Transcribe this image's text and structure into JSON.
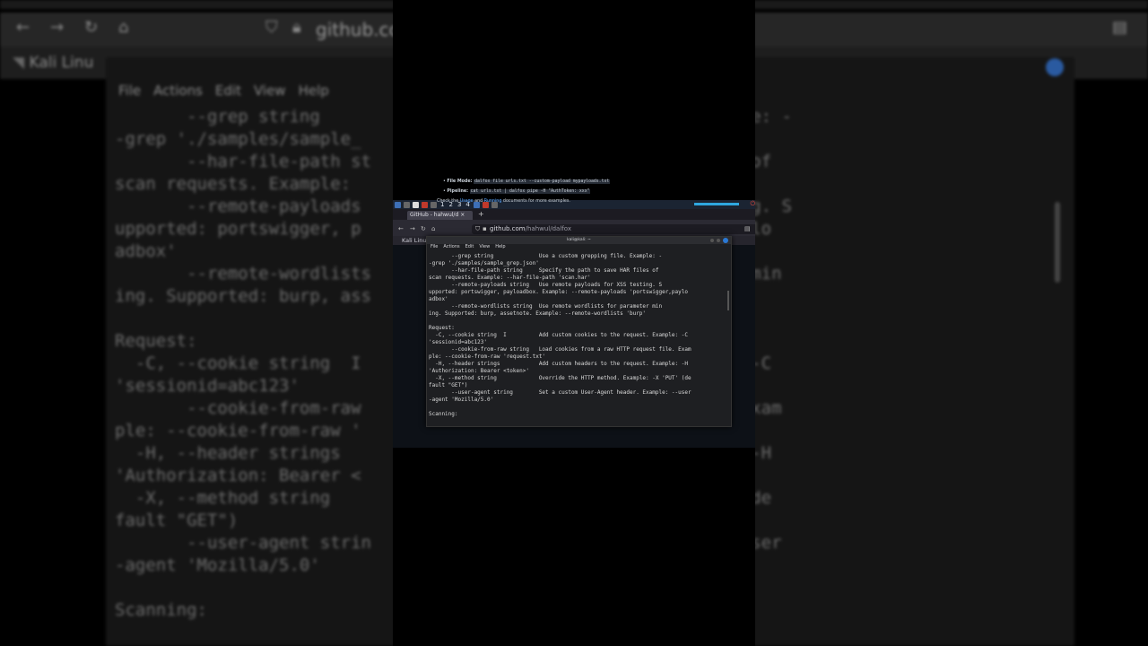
{
  "background": {
    "url_text": "github.co",
    "bookmark_label": "Kali Linu",
    "menu": [
      "File",
      "Actions",
      "Edit",
      "View",
      "Help"
    ],
    "lines": [
      "       --grep string                     grepping file. Example: -",
      "-grep './samples/sample_",
      "       --har-file-path st               ath to save HAR files of",
      "scan requests. Example:",
      "       --remote-payloads                ayloads for XSS testing. S",
      "upported: portswigger, p                loads 'portswigger,paylo",
      "adbox'",
      "       --remote-wordlists               rdlists for parameter min",
      "ing. Supported: burp, ass               lists 'burp'",
      "",
      "Request:",
      "  -C, --cookie string  I                the request. Example: -C",
      "'sessionid=abc123'",
      "       --cookie-from-raw                w HTTP request file. Exam",
      "ple: --cookie-from-raw '",
      "  -H, --header strings                  the request. Example: -H",
      "'Authorization: Bearer <",
      "  -X, --method string                  od. Example: -X 'PUT' (de",
      "fault \"GET\")",
      "       --user-agent strin               t header. Example: --user",
      "-agent 'Mozilla/5.0'",
      "",
      "Scanning:"
    ]
  },
  "taskbar": {
    "workspaces": [
      "1",
      "2",
      "3",
      "4"
    ]
  },
  "browser": {
    "tab_title": "GitHub - hahwul/d",
    "tab_plus": "+",
    "url_domain": "github.com",
    "url_path": "/hahwul/dalfox",
    "bookmark": "Kali Linux"
  },
  "github": {
    "item1_label": "File Mode:",
    "item1_code": "dalfox file urls.txt --custom-payload mypayloads.txt",
    "item2_label": "Pipeline:",
    "item2_code": "cat urls.txt | dalfox pipe -H \"AuthToken: xxx\"",
    "check_text_1": "Check the",
    "check_link_1": "Usage",
    "check_text_2": "and",
    "check_link_2": "Running",
    "check_text_3": "documents for more examples."
  },
  "terminal": {
    "title": "kali@kali: ~",
    "menu": [
      "File",
      "Actions",
      "Edit",
      "View",
      "Help"
    ],
    "lines": [
      "       --grep string              Use a custom grepping file. Example: -",
      "-grep './samples/sample_grep.json'",
      "       --har-file-path string     Specify the path to save HAR files of",
      "scan requests. Example: --har-file-path 'scan.har'",
      "       --remote-payloads string   Use remote payloads for XSS testing. S",
      "upported: portswigger, payloadbox. Example: --remote-payloads 'portswigger,paylo",
      "adbox'",
      "       --remote-wordlists string  Use remote wordlists for parameter min",
      "ing. Supported: burp, assetnote. Example: --remote-wordlists 'burp'",
      "",
      "Request:",
      "  -C, --cookie string  I          Add custom cookies to the request. Example: -C",
      "'sessionid=abc123'",
      "       --cookie-from-raw string   Load cookies from a raw HTTP request file. Exam",
      "ple: --cookie-from-raw 'request.txt'",
      "  -H, --header strings            Add custom headers to the request. Example: -H",
      "'Authorization: Bearer <token>'",
      "  -X, --method string             Override the HTTP method. Example: -X 'PUT' (de",
      "fault \"GET\")",
      "       --user-agent string        Set a custom User-Agent header. Example: --user",
      "-agent 'Mozilla/5.0'",
      "",
      "Scanning:"
    ]
  }
}
